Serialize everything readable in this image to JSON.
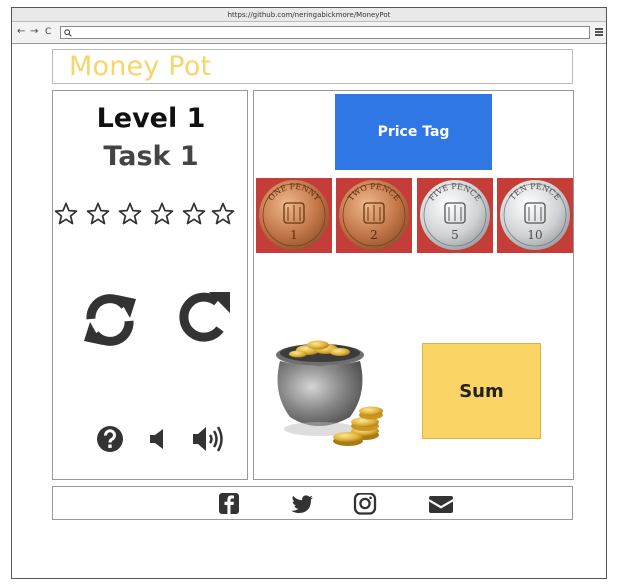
{
  "browser": {
    "url": "https://github.com/neringabickmore/MoneyPot",
    "back_glyph": "←",
    "forward_glyph": "→",
    "reload_glyph": "C"
  },
  "header": {
    "brand": "Money Pot",
    "brand_color": "#f6d56a"
  },
  "game": {
    "level_label": "Level 1",
    "task_label": "Task 1",
    "stars_total": 6,
    "stars_earned": 0
  },
  "board": {
    "price_tag_label": "Price Tag",
    "price_tag_color": "#2f77e4",
    "sum_label": "Sum",
    "sum_color": "#fad565",
    "coins": [
      {
        "name": "one-penny",
        "legend": "ONE PENNY",
        "numeral": "1",
        "metal": "copper"
      },
      {
        "name": "two-pence",
        "legend": "TWO PENCE",
        "numeral": "2",
        "metal": "copper"
      },
      {
        "name": "five-pence",
        "legend": "FIVE PENCE",
        "numeral": "5",
        "metal": "silver"
      },
      {
        "name": "ten-pence",
        "legend": "TEN PENCE",
        "numeral": "10",
        "metal": "silver"
      }
    ]
  },
  "icons": {
    "restart": "sync-icon",
    "redo": "redo-icon",
    "help": "question-circle-icon",
    "volume_down": "volume-down-icon",
    "volume_up": "volume-up-icon",
    "social": [
      "facebook-icon",
      "twitter-icon",
      "instagram-icon",
      "envelope-icon"
    ]
  }
}
